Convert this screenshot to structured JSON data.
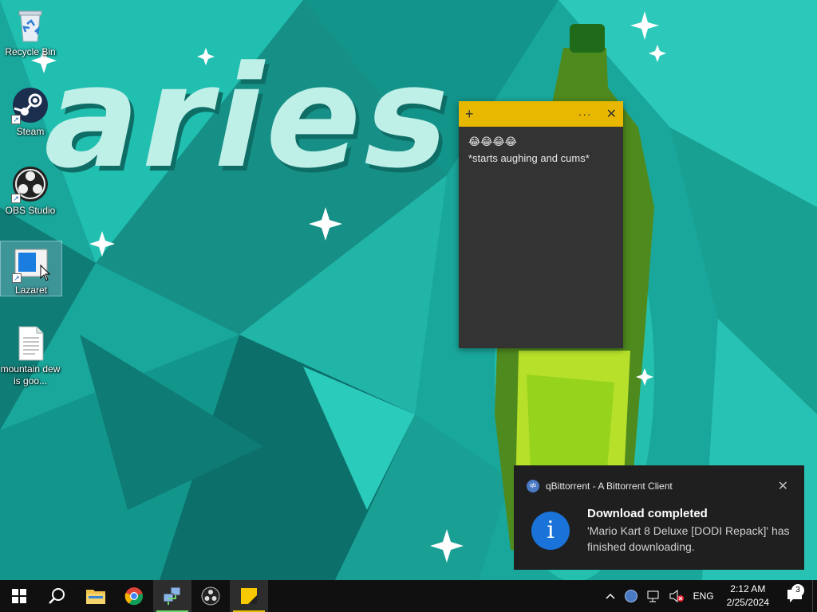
{
  "wallpaper": {
    "text": "aries"
  },
  "desktop_icons": [
    {
      "label": "Recycle Bin"
    },
    {
      "label": "Steam"
    },
    {
      "label": "OBS Studio"
    },
    {
      "label": "Lazaret"
    },
    {
      "label": "mountain dew is goo..."
    }
  ],
  "sticky_note": {
    "add_symbol": "+",
    "menu_symbol": "···",
    "close_symbol": "✕",
    "emoji_line": "😂😂😂😂",
    "text_line": "*starts aughing and cums*",
    "header_color": "#e8b700",
    "body_color": "#333333"
  },
  "toast": {
    "app_name": "qBittorrent - A Bittorrent Client",
    "app_icon_text": "qb",
    "close_symbol": "✕",
    "info_symbol": "i",
    "title": "Download completed",
    "message": "'Mario Kart 8 Deluxe [DODI Repack]' has finished downloading."
  },
  "taskbar": {
    "language": "ENG",
    "time": "2:12 AM",
    "date": "2/25/2024",
    "notification_count": "3"
  },
  "colors": {
    "accent": "#1a73d9",
    "taskbar": "#101010"
  }
}
